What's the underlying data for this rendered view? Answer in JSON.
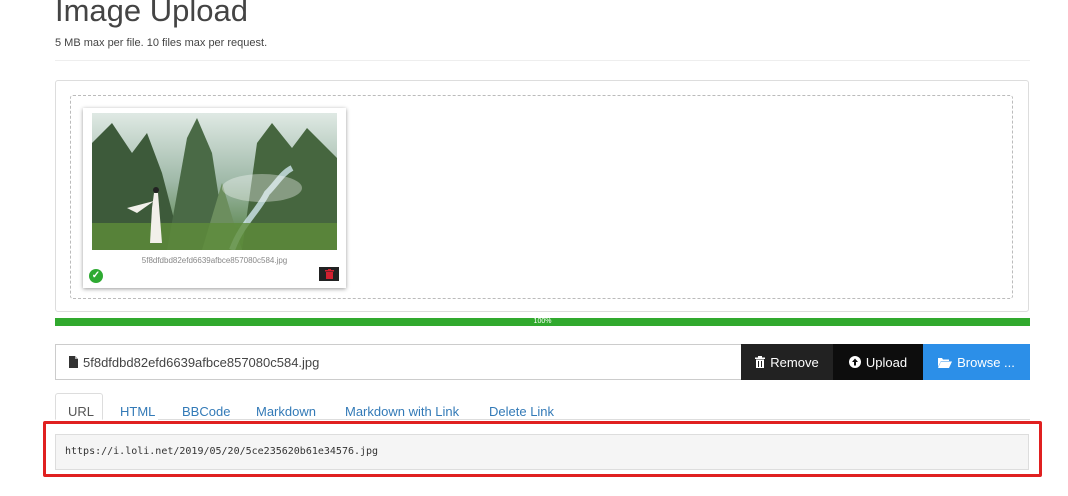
{
  "page": {
    "title": "Image Upload",
    "subtitle": "5 MB max per file. 10 files max per request."
  },
  "preview": {
    "filename": "5f8dfdbd82efd6639afbce857080c584.jpg",
    "status_icon": "check-circle-icon",
    "remove_icon": "trash-icon"
  },
  "progress": {
    "value": 100,
    "label": "100%",
    "color": "#31a92e"
  },
  "file_field": {
    "icon": "file-icon",
    "value": "5f8dfdbd82efd6639afbce857080c584.jpg"
  },
  "buttons": {
    "remove": {
      "label": "Remove",
      "icon": "trash-icon",
      "color": "#222222"
    },
    "upload": {
      "label": "Upload",
      "icon": "upload-circle-icon",
      "color": "#0d0d0d"
    },
    "browse": {
      "label": "Browse ...",
      "icon": "folder-open-icon",
      "color": "#2c8fe8"
    }
  },
  "tabs": [
    {
      "label": "URL",
      "active": true
    },
    {
      "label": "HTML",
      "active": false
    },
    {
      "label": "BBCode",
      "active": false
    },
    {
      "label": "Markdown",
      "active": false
    },
    {
      "label": "Markdown with Link",
      "active": false
    },
    {
      "label": "Delete Link",
      "active": false
    }
  ],
  "output": {
    "value": "https://i.loli.net/2019/05/20/5ce235620b61e34576.jpg"
  },
  "colors": {
    "link": "#337ab7",
    "highlight": "#e02020"
  }
}
